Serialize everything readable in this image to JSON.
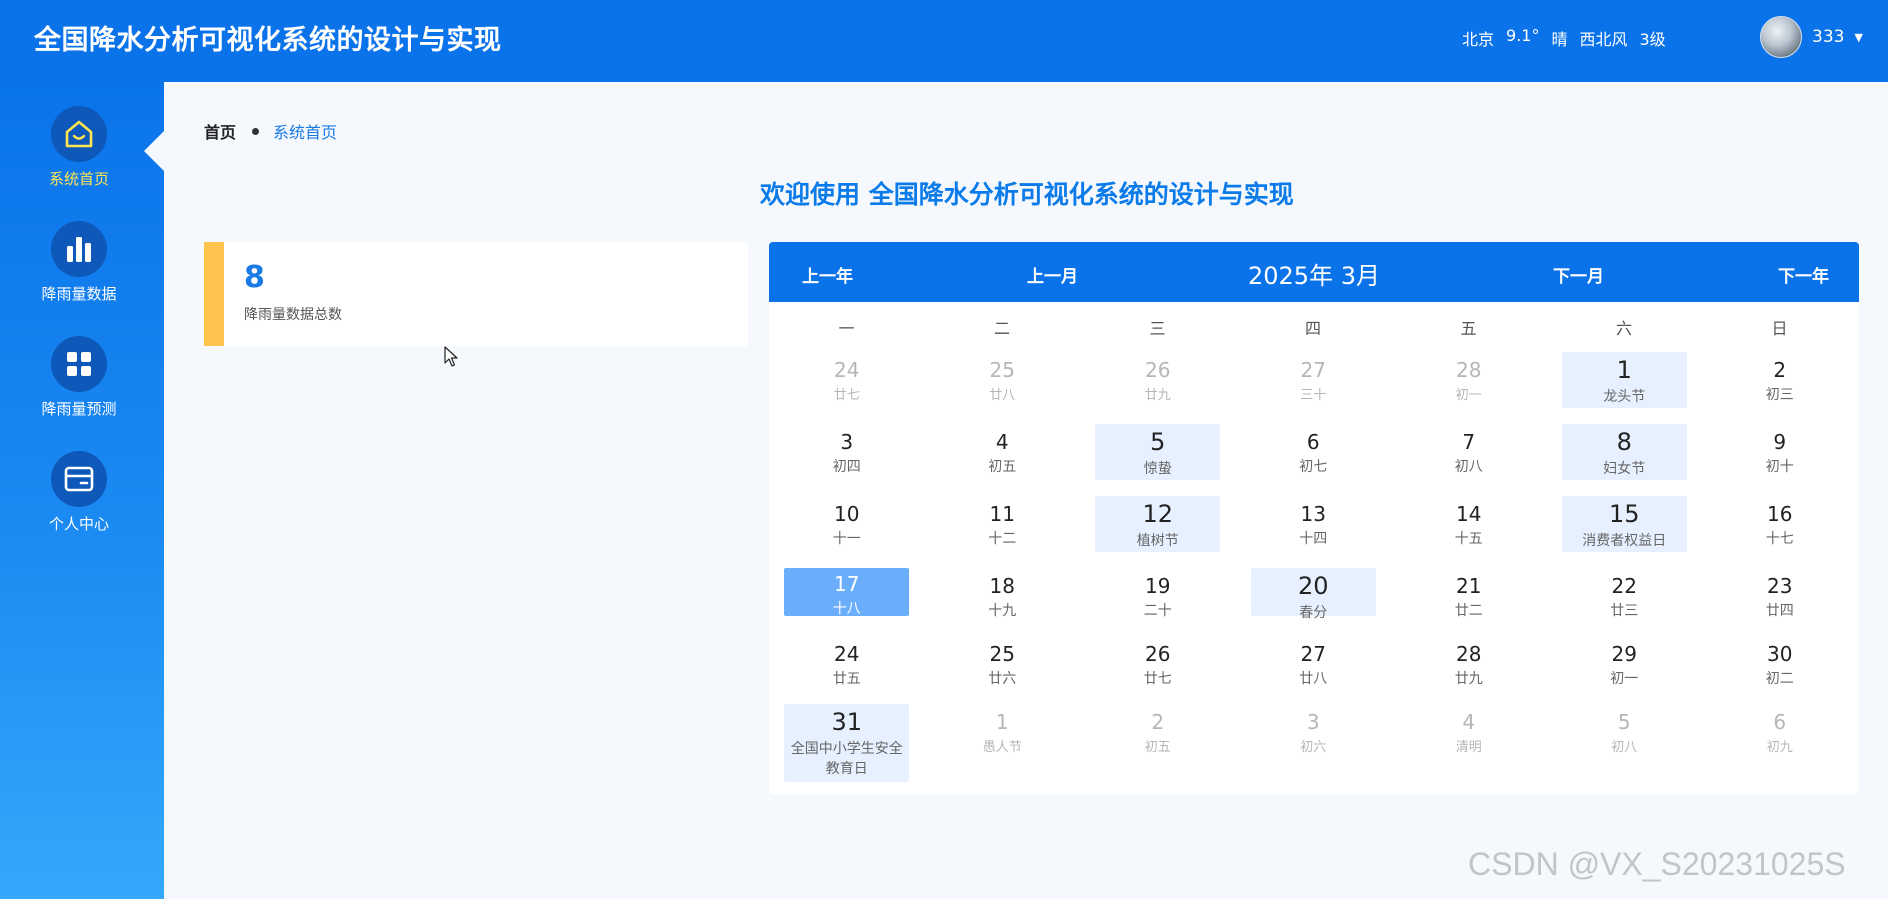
{
  "header": {
    "title": "全国降水分析可视化系统的设计与实现",
    "weather": {
      "city": "北京",
      "temp": "9.1°",
      "condition": "晴",
      "wind": "西北风",
      "level": "3级"
    },
    "username": "333"
  },
  "sidebar": {
    "items": [
      {
        "label": "系统首页",
        "icon": "home-icon",
        "active": true
      },
      {
        "label": "降雨量数据",
        "icon": "bar-chart-icon",
        "active": false
      },
      {
        "label": "降雨量预测",
        "icon": "grid-icon",
        "active": false
      },
      {
        "label": "个人中心",
        "icon": "card-icon",
        "active": false
      }
    ]
  },
  "breadcrumb": {
    "home": "首页",
    "current": "系统首页"
  },
  "welcome": "欢迎使用 全国降水分析可视化系统的设计与实现",
  "stat": {
    "value": "8",
    "label": "降雨量数据总数"
  },
  "calendar": {
    "prev_year": "上一年",
    "prev_month": "上一月",
    "title": "2025年 3月",
    "next_month": "下一月",
    "next_year": "下一年",
    "weekdays": [
      "一",
      "二",
      "三",
      "四",
      "五",
      "六",
      "日"
    ],
    "weeks": [
      [
        {
          "day": "24",
          "lunar": "廿七",
          "other": true
        },
        {
          "day": "25",
          "lunar": "廿八",
          "other": true
        },
        {
          "day": "26",
          "lunar": "廿九",
          "other": true
        },
        {
          "day": "27",
          "lunar": "三十",
          "other": true
        },
        {
          "day": "28",
          "lunar": "初一",
          "other": true
        },
        {
          "day": "1",
          "lunar": "龙头节",
          "festival": true
        },
        {
          "day": "2",
          "lunar": "初三"
        }
      ],
      [
        {
          "day": "3",
          "lunar": "初四"
        },
        {
          "day": "4",
          "lunar": "初五"
        },
        {
          "day": "5",
          "lunar": "惊蛰",
          "festival": true
        },
        {
          "day": "6",
          "lunar": "初七"
        },
        {
          "day": "7",
          "lunar": "初八"
        },
        {
          "day": "8",
          "lunar": "妇女节",
          "festival": true
        },
        {
          "day": "9",
          "lunar": "初十"
        }
      ],
      [
        {
          "day": "10",
          "lunar": "十一"
        },
        {
          "day": "11",
          "lunar": "十二"
        },
        {
          "day": "12",
          "lunar": "植树节",
          "festival": true
        },
        {
          "day": "13",
          "lunar": "十四"
        },
        {
          "day": "14",
          "lunar": "十五"
        },
        {
          "day": "15",
          "lunar": "消费者权益日",
          "festival": true
        },
        {
          "day": "16",
          "lunar": "十七"
        }
      ],
      [
        {
          "day": "17",
          "lunar": "十八",
          "today": true
        },
        {
          "day": "18",
          "lunar": "十九"
        },
        {
          "day": "19",
          "lunar": "二十"
        },
        {
          "day": "20",
          "lunar": "春分",
          "festival": true
        },
        {
          "day": "21",
          "lunar": "廿二"
        },
        {
          "day": "22",
          "lunar": "廿三"
        },
        {
          "day": "23",
          "lunar": "廿四"
        }
      ],
      [
        {
          "day": "24",
          "lunar": "廿五"
        },
        {
          "day": "25",
          "lunar": "廿六"
        },
        {
          "day": "26",
          "lunar": "廿七"
        },
        {
          "day": "27",
          "lunar": "廿八"
        },
        {
          "day": "28",
          "lunar": "廿九"
        },
        {
          "day": "29",
          "lunar": "初一"
        },
        {
          "day": "30",
          "lunar": "初二"
        }
      ],
      [
        {
          "day": "31",
          "lunar": "全国中小学生安全教育日",
          "festival": true
        },
        {
          "day": "1",
          "lunar": "愚人节",
          "other": true
        },
        {
          "day": "2",
          "lunar": "初五",
          "other": true
        },
        {
          "day": "3",
          "lunar": "初六",
          "other": true
        },
        {
          "day": "4",
          "lunar": "清明",
          "other": true
        },
        {
          "day": "5",
          "lunar": "初八",
          "other": true
        },
        {
          "day": "6",
          "lunar": "初九",
          "other": true
        }
      ]
    ]
  },
  "watermark": "CSDN @VX_S20231025S",
  "colors": {
    "primary": "#0a73ea",
    "accent_yellow": "#ffc34d",
    "active_label": "#ffe452",
    "festival_bg": "#e6f0ff",
    "today_bg": "#6aaefb"
  }
}
